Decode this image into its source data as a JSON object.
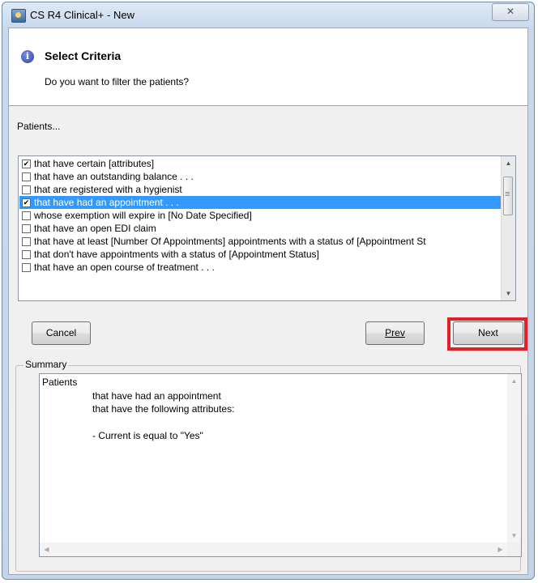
{
  "window": {
    "title": "CS R4 Clinical+ - New",
    "close_glyph": "✕"
  },
  "header": {
    "title": "Select Criteria",
    "subtitle": "Do you want to filter the patients?",
    "info_glyph": "i"
  },
  "patients_label": "Patients...",
  "criteria": [
    {
      "label": "that have certain [attributes]",
      "checked": true,
      "selected": false
    },
    {
      "label": "that have an outstanding balance . . .",
      "checked": false,
      "selected": false
    },
    {
      "label": "that are registered with a hygienist",
      "checked": false,
      "selected": false
    },
    {
      "label": "that have had an appointment . . .",
      "checked": true,
      "selected": true
    },
    {
      "label": "whose exemption will expire in [No Date Specified]",
      "checked": false,
      "selected": false
    },
    {
      "label": "that have an open EDI claim",
      "checked": false,
      "selected": false
    },
    {
      "label": "that have at least [Number Of Appointments] appointments with a status of [Appointment St",
      "checked": false,
      "selected": false
    },
    {
      "label": "that don't have appointments with a status of [Appointment Status]",
      "checked": false,
      "selected": false
    },
    {
      "label": "that have an open course of treatment . . .",
      "checked": false,
      "selected": false
    }
  ],
  "buttons": {
    "cancel": "Cancel",
    "prev": "Prev",
    "next": "Next"
  },
  "summary": {
    "legend": "Summary",
    "heading": "Patients",
    "line1": "that have had an appointment",
    "line2": "that have the following attributes:",
    "line3": "- Current is equal to \"Yes\""
  },
  "colors": {
    "selection": "#3399ff",
    "highlight": "#e0202a"
  }
}
